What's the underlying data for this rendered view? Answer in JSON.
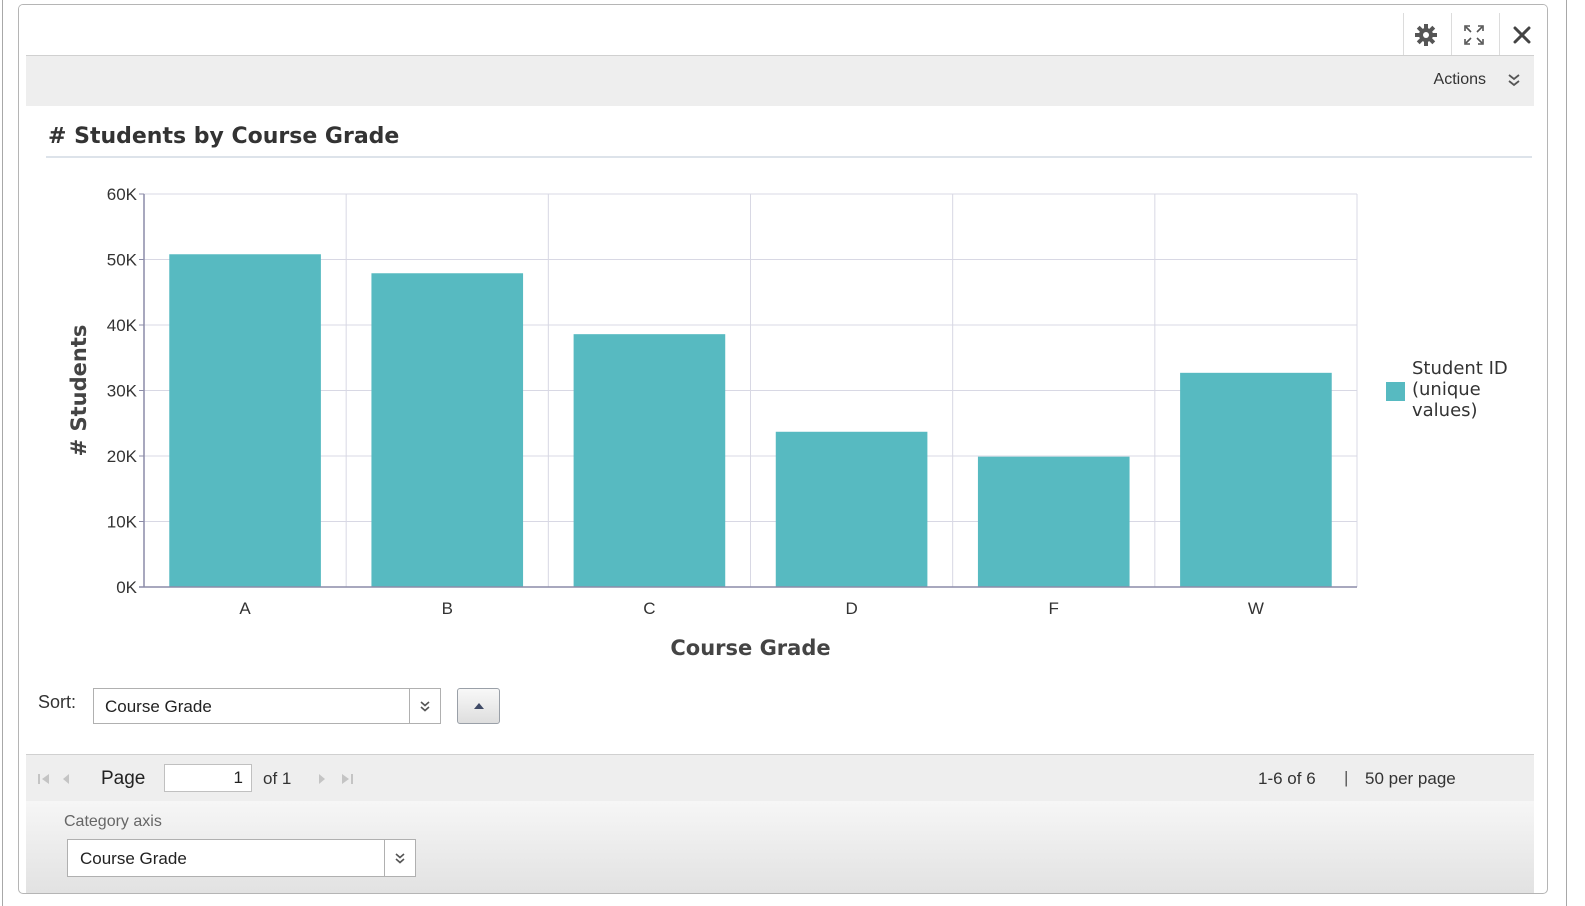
{
  "window": {
    "settings_icon": "gear-icon",
    "expand_icon": "expand-icon",
    "close_icon": "close-icon"
  },
  "actions_bar": {
    "label": "Actions",
    "icon": "double-chevron-down-icon"
  },
  "sort": {
    "label": "Sort:",
    "selected": "Course Grade",
    "direction": "ascending"
  },
  "pager": {
    "page_label": "Page",
    "page_value": "1",
    "of_label": "of 1",
    "range_label": "1-6 of 6",
    "separator": "|",
    "per_page_label": "50 per page"
  },
  "category_axis": {
    "label": "Category axis",
    "selected": "Course Grade"
  },
  "colors": {
    "bar": "#57bac1",
    "grid": "#d8d8e4",
    "axis": "#8c8ca8"
  },
  "chart_data": {
    "type": "bar",
    "title": "# Students by Course Grade",
    "xlabel": "Course Grade",
    "ylabel": "# Students",
    "categories": [
      "A",
      "B",
      "C",
      "D",
      "F",
      "W"
    ],
    "series": [
      {
        "name": "Student ID (unique values)",
        "values": [
          50800,
          47900,
          38600,
          23700,
          19900,
          32700
        ]
      }
    ],
    "ylim": [
      0,
      60000
    ],
    "yticks": [
      0,
      10000,
      20000,
      30000,
      40000,
      50000,
      60000
    ],
    "ytick_labels": [
      "0K",
      "10K",
      "20K",
      "30K",
      "40K",
      "50K",
      "60K"
    ],
    "grid": true,
    "legend": "right"
  }
}
